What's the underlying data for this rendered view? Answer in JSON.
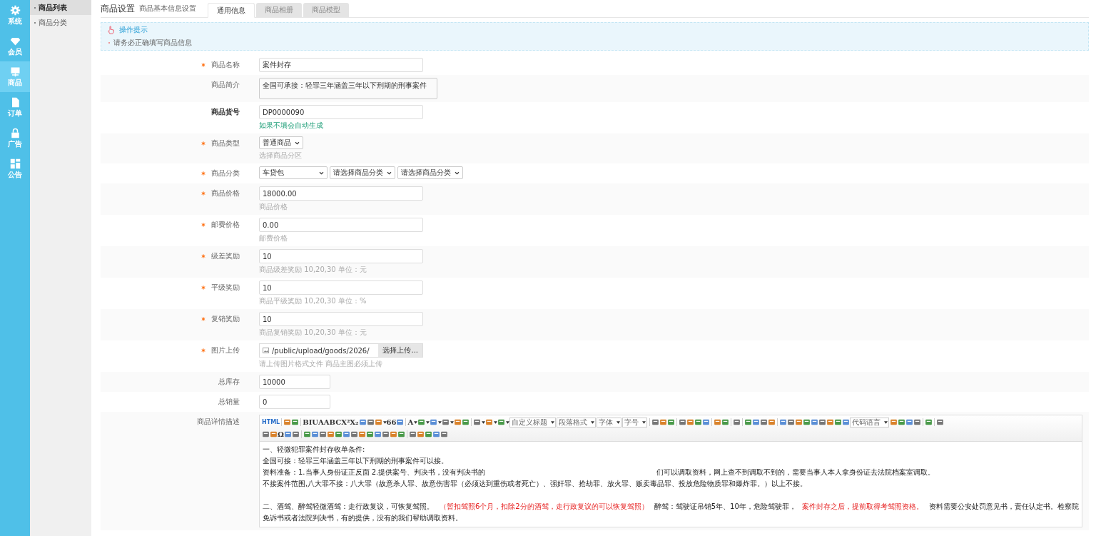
{
  "nav": [
    {
      "label": "系统",
      "selected": false
    },
    {
      "label": "会员",
      "selected": false
    },
    {
      "label": "商品",
      "selected": true
    },
    {
      "label": "订单",
      "selected": false
    },
    {
      "label": "广告",
      "selected": false
    },
    {
      "label": "公告",
      "selected": false
    }
  ],
  "submenu": [
    {
      "label": "商品列表",
      "selected": true
    },
    {
      "label": "商品分类",
      "selected": false
    }
  ],
  "header": {
    "title": "商品设置",
    "subtitle": "商品基本信息设置"
  },
  "tabs": [
    {
      "label": "通用信息",
      "selected": true
    },
    {
      "label": "商品相册",
      "selected": false
    },
    {
      "label": "商品模型",
      "selected": false
    }
  ],
  "tip": {
    "title": "操作提示",
    "items": [
      "请务必正确填写商品信息"
    ]
  },
  "form": [
    {
      "kind": "text",
      "label": "商品名称",
      "required": true,
      "value": "案件封存"
    },
    {
      "kind": "textarea",
      "label": "商品简介",
      "required": false,
      "value": "全国可承接：轻罪三年涵盖三年以下刑期的刑事案件"
    },
    {
      "kind": "text",
      "label": "商品货号",
      "required": false,
      "strong": true,
      "value": "DP0000090",
      "hint": {
        "text": "如果不填会自动生成",
        "success": true
      }
    },
    {
      "kind": "selects",
      "label": "商品类型",
      "required": true,
      "options": [
        "普通商品"
      ],
      "hint": {
        "text": "选择商品分区",
        "success": false
      }
    },
    {
      "kind": "selects",
      "label": "商品分类",
      "required": true,
      "options": [
        "车贷包",
        "请选择商品分类",
        "请选择商品分类"
      ]
    },
    {
      "kind": "text",
      "label": "商品价格",
      "required": true,
      "value": "18000.00",
      "hint": {
        "text": "商品价格",
        "success": false
      }
    },
    {
      "kind": "text",
      "label": "邮费价格",
      "required": true,
      "value": "0.00",
      "hint": {
        "text": "邮费价格",
        "success": false
      }
    },
    {
      "kind": "text",
      "label": "级差奖励",
      "required": true,
      "value": "10",
      "hint": {
        "text": "商品级差奖励 10,20,30 单位：元",
        "success": false
      }
    },
    {
      "kind": "text",
      "label": "平级奖励",
      "required": true,
      "value": "10",
      "hint": {
        "text": "商品平级奖励 10,20,30 单位：%",
        "success": false
      }
    },
    {
      "kind": "text",
      "label": "复销奖励",
      "required": true,
      "value": "10",
      "hint": {
        "text": "商品复销奖励 10,20,30 单位：元",
        "success": false
      }
    },
    {
      "kind": "file",
      "label": "图片上传",
      "required": true,
      "value": "/public/upload/goods/2026/",
      "button": "选择上传...",
      "hint": {
        "text": "请上传图片格式文件 商品主图必须上传",
        "success": false
      }
    },
    {
      "kind": "short",
      "label": "总库存",
      "required": false,
      "value": "10000"
    },
    {
      "kind": "short",
      "label": "总销量",
      "required": false,
      "value": "0"
    },
    {
      "kind": "editor",
      "label": "商品详情描述",
      "required": false
    }
  ],
  "editor": {
    "toolbar": [
      [
        {
          "kind": "text",
          "text": "HTML"
        },
        {
          "kind": "sep"
        },
        {
          "kind": "icon"
        },
        {
          "kind": "icon"
        },
        {
          "kind": "sep"
        },
        {
          "kind": "text",
          "text": "B"
        },
        {
          "kind": "text",
          "text": "I"
        },
        {
          "kind": "text",
          "text": "U"
        },
        {
          "kind": "text",
          "text": "A"
        },
        {
          "kind": "text",
          "text": "ABC"
        },
        {
          "kind": "text",
          "text": "X²"
        },
        {
          "kind": "text",
          "text": "X₂"
        },
        {
          "kind": "icon"
        },
        {
          "kind": "icon"
        },
        {
          "kind": "icon",
          "caret": true
        },
        {
          "kind": "text",
          "text": "66"
        },
        {
          "kind": "icon"
        },
        {
          "kind": "sep"
        },
        {
          "kind": "text",
          "text": "A",
          "caret": true
        },
        {
          "kind": "icon",
          "caret": true
        },
        {
          "kind": "icon",
          "caret": true
        },
        {
          "kind": "icon",
          "caret": true
        },
        {
          "kind": "icon"
        },
        {
          "kind": "icon"
        },
        {
          "kind": "sep"
        },
        {
          "kind": "icon",
          "caret": true
        },
        {
          "kind": "icon",
          "caret": true
        },
        {
          "kind": "icon",
          "caret": true
        },
        {
          "kind": "select",
          "text": "自定义标题"
        },
        {
          "kind": "select",
          "text": "段落格式"
        },
        {
          "kind": "select",
          "text": "字体"
        },
        {
          "kind": "select",
          "text": "字号"
        },
        {
          "kind": "sep"
        },
        {
          "kind": "icon"
        },
        {
          "kind": "icon"
        },
        {
          "kind": "icon"
        },
        {
          "kind": "sep"
        },
        {
          "kind": "icon"
        },
        {
          "kind": "icon"
        },
        {
          "kind": "icon"
        },
        {
          "kind": "icon"
        },
        {
          "kind": "sep"
        },
        {
          "kind": "icon"
        },
        {
          "kind": "icon"
        },
        {
          "kind": "sep"
        },
        {
          "kind": "icon"
        },
        {
          "kind": "sep"
        },
        {
          "kind": "icon"
        },
        {
          "kind": "icon"
        },
        {
          "kind": "icon"
        },
        {
          "kind": "icon"
        },
        {
          "kind": "sep"
        },
        {
          "kind": "icon"
        },
        {
          "kind": "icon"
        },
        {
          "kind": "icon"
        },
        {
          "kind": "icon"
        },
        {
          "kind": "icon"
        },
        {
          "kind": "icon"
        },
        {
          "kind": "icon"
        },
        {
          "kind": "icon"
        },
        {
          "kind": "icon"
        },
        {
          "kind": "select",
          "text": "代码语言"
        },
        {
          "kind": "icon"
        },
        {
          "kind": "icon"
        },
        {
          "kind": "icon"
        },
        {
          "kind": "icon"
        },
        {
          "kind": "sep"
        },
        {
          "kind": "icon"
        },
        {
          "kind": "sep"
        },
        {
          "kind": "icon"
        }
      ],
      [
        {
          "kind": "icon"
        },
        {
          "kind": "icon"
        },
        {
          "kind": "text",
          "text": "Ω"
        },
        {
          "kind": "icon"
        },
        {
          "kind": "icon"
        },
        {
          "kind": "sep"
        },
        {
          "kind": "icon"
        },
        {
          "kind": "icon"
        },
        {
          "kind": "icon"
        },
        {
          "kind": "icon"
        },
        {
          "kind": "icon"
        },
        {
          "kind": "icon"
        },
        {
          "kind": "icon"
        },
        {
          "kind": "icon"
        },
        {
          "kind": "icon"
        },
        {
          "kind": "icon"
        },
        {
          "kind": "icon"
        },
        {
          "kind": "icon"
        },
        {
          "kind": "icon"
        },
        {
          "kind": "sep"
        },
        {
          "kind": "icon"
        },
        {
          "kind": "icon"
        },
        {
          "kind": "icon"
        },
        {
          "kind": "icon"
        },
        {
          "kind": "icon"
        }
      ]
    ],
    "sections": [
      [
        [
          {
            "text": "一、轻微犯罪案件封存收单条件:",
            "highlight": false
          }
        ],
        [
          {
            "text": "全国可接：轻罪三年涵盖三年以下刑期的刑事案件可以接。",
            "highlight": false
          }
        ],
        [
          {
            "text": "资料准备：1.当事人身份证正反面  2.提供案号、判决书，没有判决书的",
            "highlight": false
          },
          {
            "text": "们可以调取资料，网上查不到调取不到的，需要当事人本人拿身份证去法院档案室调取。",
            "highlight": false
          }
        ],
        [
          {
            "text": "不接案件范围,八大罪不接：八大罪（故意杀人罪、故意伤害罪（必须达到重伤或者死亡）、强奸罪、抢劫罪、放火罪、贩卖毒品罪、投放危险物质罪和爆炸罪。）以上不接。",
            "highlight": false
          }
        ]
      ],
      [
        [
          {
            "text": "二、酒驾、醉驾轻微酒驾：走行政复议，可恢复驾照。",
            "highlight": false
          },
          {
            "text": "（暂扣驾照6个月，扣除2分的酒驾，走行政复议的可以恢复驾照）",
            "highlight": true
          },
          {
            "text": "醉驾：驾驶证吊销5年、10年，危险驾驶罪，",
            "highlight": false
          },
          {
            "text": "案件封存之后，提前取得考驾照资格。",
            "highlight": true
          },
          {
            "text": "资料需要公安处罚意见书，责任认定书。检察院免诉书或者法院判决书，有的提供，没有的我们帮助调取资料。",
            "highlight": false
          }
        ]
      ]
    ]
  }
}
